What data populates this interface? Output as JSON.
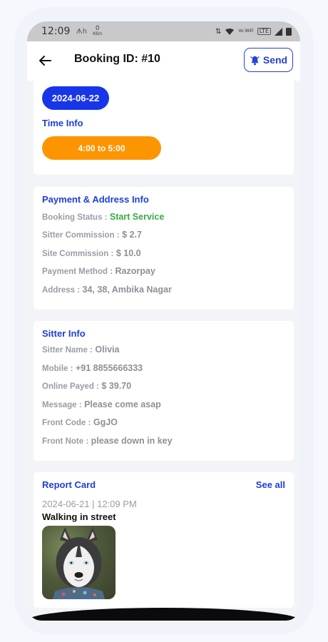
{
  "status_bar": {
    "time": "12:09",
    "network_speed_value": "0",
    "network_speed_unit": "KB/s",
    "network_icon_text": "ᗑh",
    "wifi_label": "Vo WiFi",
    "lte_label": "LTE"
  },
  "header": {
    "title": "Booking ID: #10",
    "send_label": "Send",
    "accent_color": "#2443d8"
  },
  "schedule": {
    "date": "2024-06-22",
    "time_title": "Time Info",
    "time_range": "4:00 to 5:00"
  },
  "payment": {
    "title": "Payment & Address Info",
    "booking_status_label": "Booking Status :",
    "booking_status_value": "Start Service",
    "sitter_commission_label": "Sitter Commission :",
    "sitter_commission_value": "$ 2.7",
    "site_commission_label": "Site Commission :",
    "site_commission_value": "$ 10.0",
    "payment_method_label": "Payment Method :",
    "payment_method_value": "Razorpay",
    "address_label": "Address :",
    "address_value": "34, 38, Ambika Nagar"
  },
  "sitter": {
    "title": "Sitter Info",
    "name_label": "Sitter Name :",
    "name_value": "Olivia",
    "mobile_label": "Mobile :",
    "mobile_value": "+91 8855666333",
    "online_payed_label": "Online Payed :",
    "online_payed_value": "$ 39.70",
    "message_label": "Message :",
    "message_value": "Please come asap",
    "front_code_label": "Front Code :",
    "front_code_value": "GgJO",
    "front_note_label": "Front Note :",
    "front_note_value": "please down in key"
  },
  "report": {
    "title": "Report Card",
    "see_all_label": "See all",
    "date_time": "2024-06-21 | 12:09 PM",
    "activity": "Walking in street"
  },
  "colors": {
    "date_chip": "#1736e9",
    "time_chip": "#fd9500",
    "status_green": "#3aaa45"
  },
  "icons": {
    "back": "arrow-left-icon",
    "send": "bell-icon"
  }
}
